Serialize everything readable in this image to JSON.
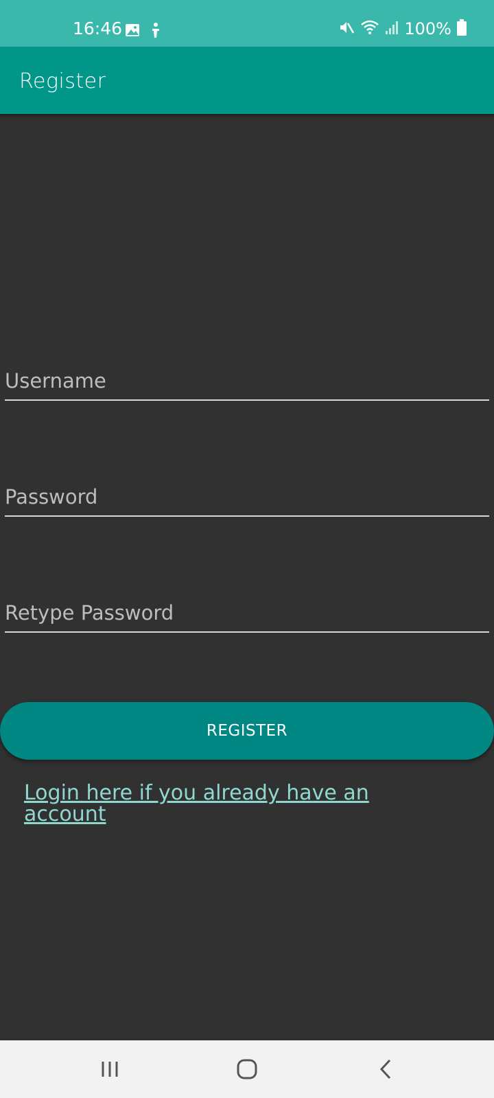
{
  "status_bar": {
    "time": "16:46",
    "battery": "100%",
    "background": "#3ab8ac",
    "left_icons": [
      "gallery-icon",
      "accessibility-icon"
    ],
    "right_icons": [
      "mute-icon",
      "wifi-icon",
      "signal-icon",
      "battery-icon"
    ]
  },
  "app_bar": {
    "title": "Register",
    "background": "#009688"
  },
  "form": {
    "username": {
      "value": "",
      "placeholder": "Username"
    },
    "password": {
      "value": "",
      "placeholder": "Password"
    },
    "retype_password": {
      "value": "",
      "placeholder": "Retype Password"
    },
    "register_label": "REGISTER",
    "register_color": "#008784",
    "login_link": "Login here if you already have an account",
    "login_link_color": "#8fd8d0"
  },
  "nav_bar": {
    "buttons": [
      "recents-icon",
      "home-icon",
      "back-icon"
    ]
  }
}
